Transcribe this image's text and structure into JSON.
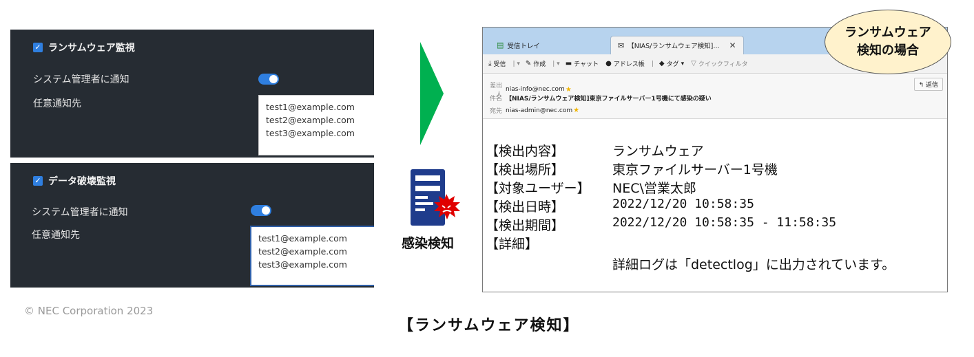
{
  "panels": [
    {
      "title": "ランサムウェア監視",
      "notify_admin_label": "システム管理者に通知",
      "notify_admin_on": true,
      "recipients_label": "任意通知先",
      "recipients": [
        "test1@example.com",
        "test2@example.com",
        "test3@example.com"
      ]
    },
    {
      "title": "データ破壊監視",
      "notify_admin_label": "システム管理者に通知",
      "notify_admin_on": true,
      "recipients_label": "任意通知先",
      "recipients": [
        "test1@example.com",
        "test2@example.com",
        "test3@example.com"
      ]
    }
  ],
  "infection_label": "感染検知",
  "mail": {
    "tabs": [
      {
        "label": "受信トレイ",
        "icon": "inbox-icon"
      },
      {
        "label": "【NIAS/ランサムウェア検知]...",
        "icon": "envelope-icon"
      }
    ],
    "toolbar": [
      {
        "label": "受信",
        "icon": "download-icon"
      },
      {
        "label": "作成",
        "icon": "pencil-icon"
      },
      {
        "label": "チャット",
        "icon": "chat-icon"
      },
      {
        "label": "アドレス帳",
        "icon": "person-icon"
      },
      {
        "label": "タグ",
        "icon": "tag-icon"
      },
      {
        "label": "クイックフィルタ",
        "icon": "filter-icon"
      }
    ],
    "from_label": "差出人",
    "from": "nias-info@nec.com",
    "subject_label": "件名",
    "subject": "【NIAS/ランサムウェア検知]東京ファイルサーバー1号機にて感染の疑い",
    "to_label": "宛先",
    "to": "nias-admin@nec.com",
    "reply_label": "返信",
    "body": [
      {
        "key": "【検出内容】",
        "value": "ランサムウェア"
      },
      {
        "key": "【検出場所】",
        "value": "東京ファイルサーバー1号機"
      },
      {
        "key": "【対象ユーザー】",
        "value": "NEC\\営業太郎"
      },
      {
        "key": "【検出日時】",
        "value": "2022/12/20 10:58:35"
      },
      {
        "key": "【検出期間】",
        "value": "2022/12/20 10:58:35 - 11:58:35"
      },
      {
        "key": "【詳細】",
        "value": ""
      }
    ],
    "detail_text": "詳細ログは「detectlog」に出力されています。"
  },
  "bubble": {
    "line1": "ランサムウェア",
    "line2": "検知の場合"
  },
  "copyright": "© NEC Corporation 2023",
  "caption": "【ランサムウェア検知】",
  "colors": {
    "panel_bg": "#262c33",
    "accent": "#2f7fe0",
    "arrow": "#00b050",
    "virus": "#e00000",
    "doc": "#1f3c8c",
    "bubble": "#fff2cc"
  }
}
